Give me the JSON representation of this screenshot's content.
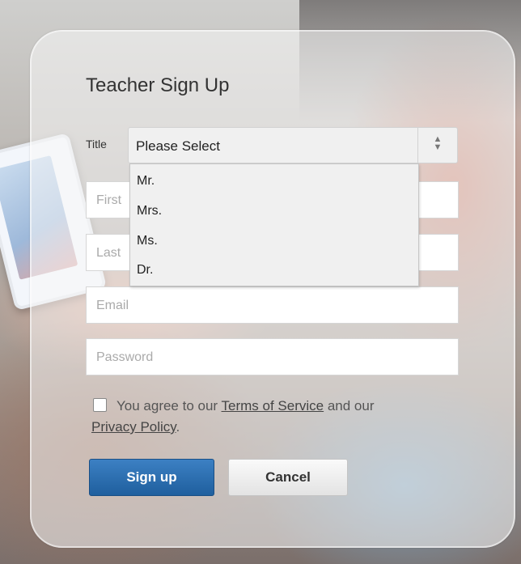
{
  "form": {
    "heading": "Teacher Sign Up",
    "title_label": "Title",
    "title_select_value": "Please Select",
    "title_options": [
      "Mr.",
      "Mrs.",
      "Ms.",
      "Dr."
    ],
    "first_name_placeholder": "First",
    "last_name_placeholder": "Last",
    "email_placeholder": "Email",
    "password_placeholder": "Password",
    "agree_prefix": "You agree to our",
    "terms_link": "Terms of Service",
    "agree_middle": "and our",
    "privacy_link": "Privacy Policy",
    "agree_suffix": ".",
    "signup_button": "Sign up",
    "cancel_button": "Cancel"
  },
  "icons": {
    "select_arrow": "up-down-chevron-icon",
    "checkbox": "checkbox-icon"
  },
  "colors": {
    "primary_button": "#2a6eb0",
    "secondary_button": "#efefef",
    "text": "#333333"
  }
}
